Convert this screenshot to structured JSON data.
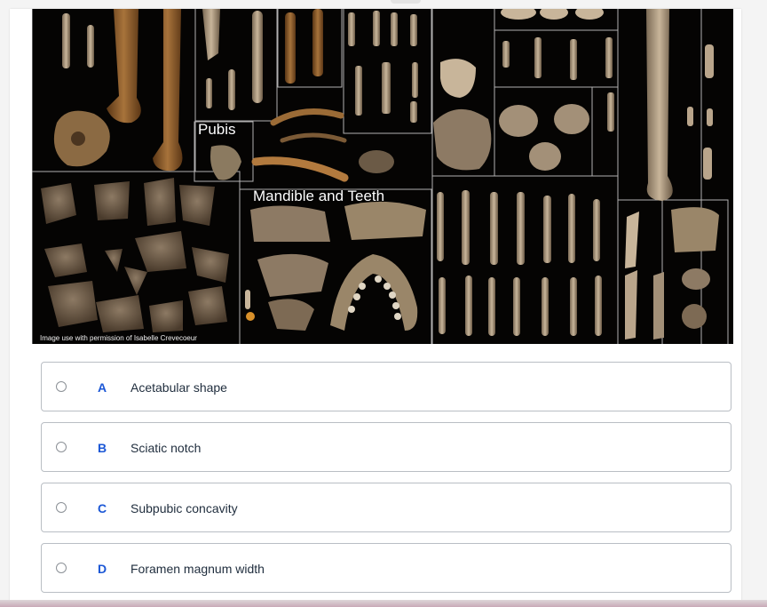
{
  "figure": {
    "labels": {
      "pubis": "Pubis",
      "mandible": "Mandible and Teeth"
    },
    "credit": "Image use with permission of Isabelle Crevecoeur"
  },
  "options": [
    {
      "letter": "A",
      "text": "Acetabular shape"
    },
    {
      "letter": "B",
      "text": "Sciatic notch"
    },
    {
      "letter": "C",
      "text": "Subpubic concavity"
    },
    {
      "letter": "D",
      "text": "Foramen magnum width"
    }
  ],
  "colors": {
    "accent": "#1b57d6",
    "border": "#b9bec4",
    "bone": "#8a5a2b",
    "figure_bg": "#050403"
  }
}
